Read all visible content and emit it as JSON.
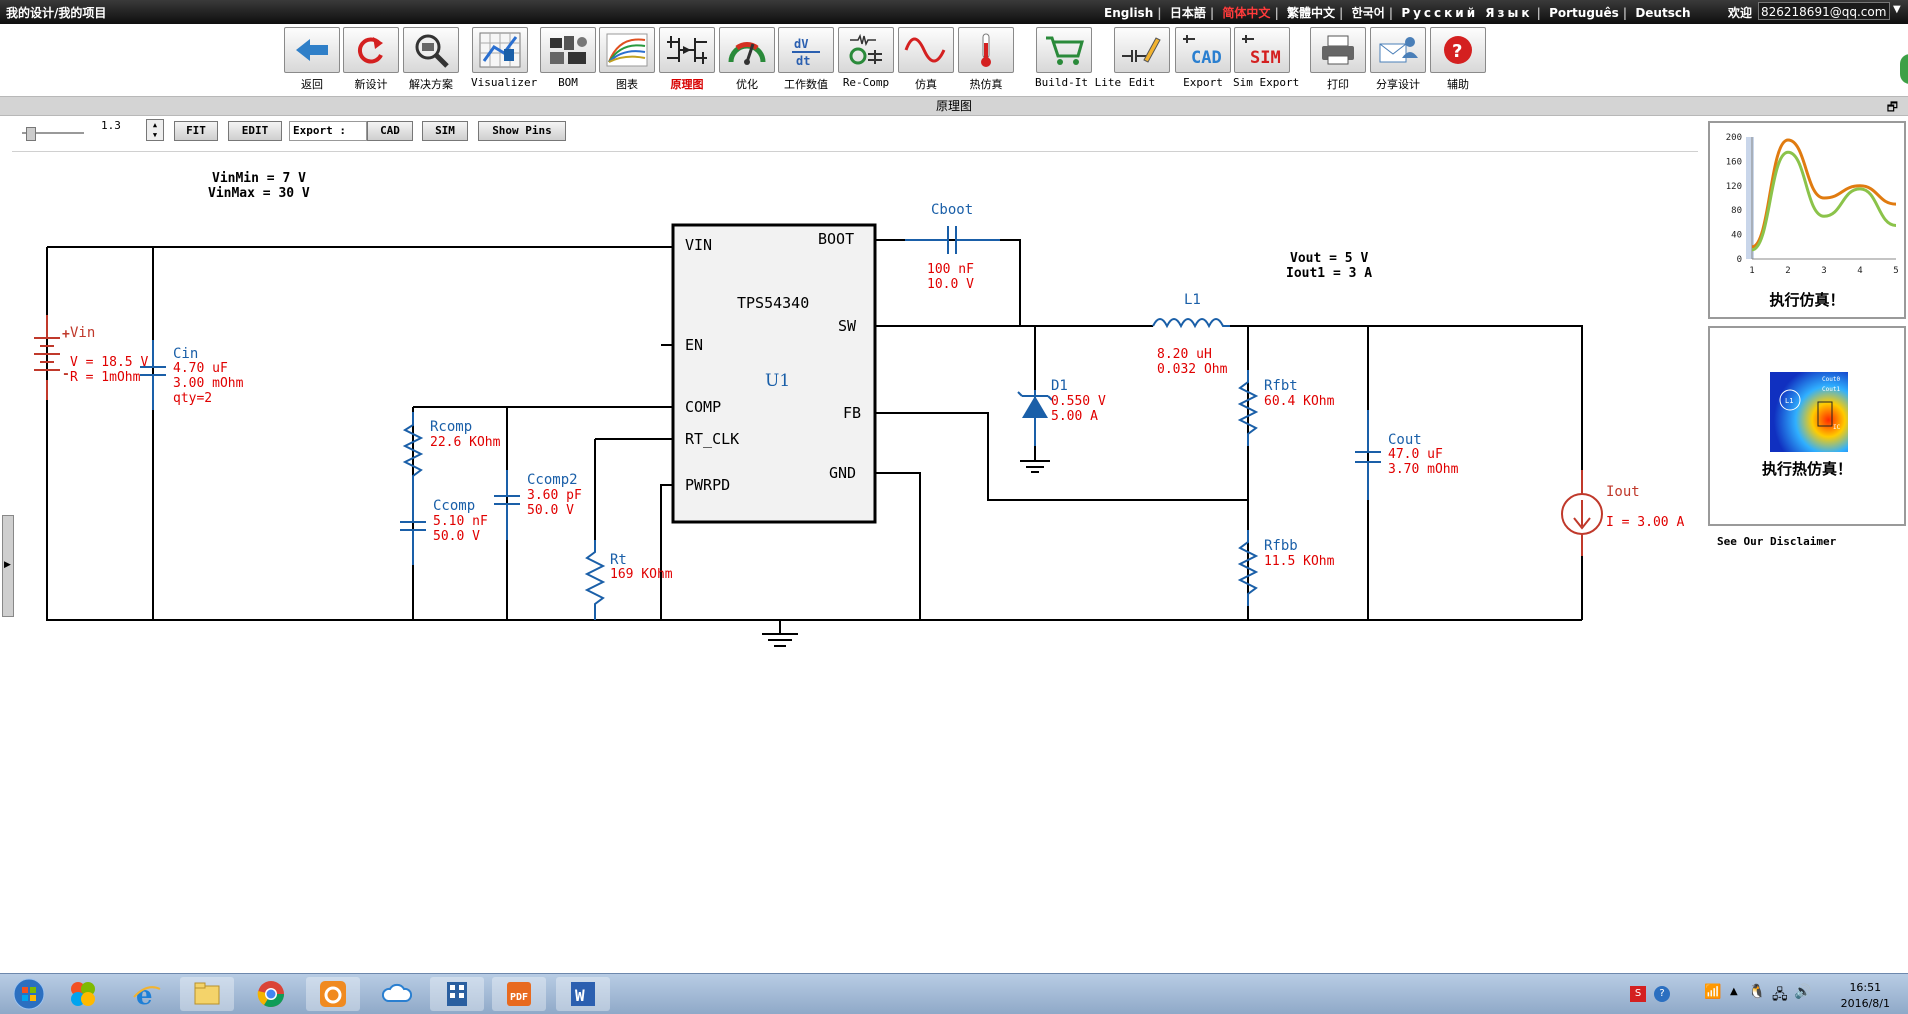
{
  "topbar": {
    "breadcrumb": "我的设计/我的项目",
    "languages": [
      "English",
      "日本語",
      "简体中文",
      "繁體中文",
      "한국어",
      "Русский Язык",
      "Português",
      "Deutsch"
    ],
    "active_language": "简体中文",
    "welcome": "欢迎",
    "account": "826218691@qq.com"
  },
  "toolbar": [
    {
      "label": "返回",
      "icon": "back-arrow-icon"
    },
    {
      "label": "新设计",
      "icon": "refresh-icon"
    },
    {
      "label": "解决方案",
      "icon": "magnifier-icon"
    },
    {
      "label": "Visualizer",
      "icon": "visualizer-icon"
    },
    {
      "label": "BOM",
      "icon": "bom-icon"
    },
    {
      "label": "图表",
      "icon": "chart-icon"
    },
    {
      "label": "原理图",
      "icon": "schematic-icon",
      "active": true
    },
    {
      "label": "优化",
      "icon": "gauge-icon"
    },
    {
      "label": "工作数值",
      "icon": "dvdt-icon"
    },
    {
      "label": "Re-Comp",
      "icon": "recomp-icon"
    },
    {
      "label": "仿真",
      "icon": "sine-icon"
    },
    {
      "label": "热仿真",
      "icon": "thermometer-icon"
    },
    {
      "label": "Build-It Lite",
      "icon": "cart-icon"
    },
    {
      "label": "Edit",
      "icon": "edit-icon"
    },
    {
      "label": "Export",
      "icon": "cad-icon"
    },
    {
      "label": "Sim Export",
      "icon": "sim-icon"
    },
    {
      "label": "打印",
      "icon": "printer-icon"
    },
    {
      "label": "分享设计",
      "icon": "share-icon"
    },
    {
      "label": "辅助",
      "icon": "help-icon"
    }
  ],
  "panel": {
    "title": "原理图"
  },
  "controls": {
    "zoom": "1.3",
    "fit": "FIT",
    "edit": "EDIT",
    "export_label": "Export :",
    "cad": "CAD",
    "sim": "SIM",
    "show_pins": "Show Pins"
  },
  "schematic": {
    "vin_min": "VinMin = 7 V",
    "vin_max": "VinMax = 30 V",
    "vout": "Vout = 5 V",
    "iout1": "Iout1 = 3 A",
    "ic": {
      "part": "TPS54340",
      "ref": "U1",
      "pins": {
        "vin": "VIN",
        "en": "EN",
        "comp": "COMP",
        "rt_clk": "RT_CLK",
        "pwrpd": "PWRPD",
        "boot": "BOOT",
        "sw": "SW",
        "fb": "FB",
        "gnd": "GND"
      }
    },
    "vin": {
      "name": "Vin",
      "v": "V = 18.5 V",
      "r": "R = 1mOhm"
    },
    "cin": {
      "name": "Cin",
      "c": "4.70 uF",
      "esr": "3.00 mOhm",
      "qty": "qty=2"
    },
    "rcomp": {
      "name": "Rcomp",
      "r": "22.6 KOhm"
    },
    "ccomp": {
      "name": "Ccomp",
      "c": "5.10 nF",
      "v": "50.0 V"
    },
    "ccomp2": {
      "name": "Ccomp2",
      "c": "3.60 pF",
      "v": "50.0 V"
    },
    "rt": {
      "name": "Rt",
      "r": "169 KOhm"
    },
    "cboot": {
      "name": "Cboot",
      "c": "100 nF",
      "v": "10.0 V"
    },
    "l1": {
      "name": "L1",
      "l": "8.20 uH",
      "r": "0.032 Ohm"
    },
    "d1": {
      "name": "D1",
      "v": "0.550 V",
      "i": "5.00 A"
    },
    "rfbt": {
      "name": "Rfbt",
      "r": "60.4 KOhm"
    },
    "rfbb": {
      "name": "Rfbb",
      "r": "11.5 KOhm"
    },
    "cout": {
      "name": "Cout",
      "c": "47.0 uF",
      "esr": "3.70 mOhm"
    },
    "iout": {
      "name": "Iout",
      "i": "I = 3.00 A"
    }
  },
  "sim_panel": {
    "caption": "执行仿真！"
  },
  "thermal_panel": {
    "caption": "执行热仿真！",
    "tiny_labels": [
      "L1",
      "Cout0",
      "Cout1",
      "IC"
    ]
  },
  "disclaimer": "See Our Disclaimer",
  "chart_data": {
    "type": "line",
    "x": [
      1,
      2,
      3,
      4,
      5
    ],
    "xlim": [
      1,
      5
    ],
    "ylim": [
      0,
      200
    ],
    "yticks": [
      0,
      40,
      80,
      120,
      160,
      200
    ],
    "xticks": [
      1,
      2,
      3,
      4,
      5
    ],
    "series": [
      {
        "color": "#e07b10",
        "values": [
          20,
          195,
          100,
          120,
          90
        ]
      },
      {
        "color": "#8bc34a",
        "values": [
          15,
          175,
          70,
          115,
          55
        ]
      }
    ]
  },
  "taskbar": {
    "apps": [
      "start-orb-icon",
      "windows-icon",
      "ie-icon",
      "explorer-icon",
      "chrome-icon",
      "uc-browser-icon",
      "baidu-cloud-icon",
      "video-icon",
      "pdf-icon",
      "word-icon"
    ],
    "time": "16:51",
    "date": "2016/8/1"
  },
  "colors": {
    "wire": "#000000",
    "part": "#1a5fa8",
    "value": "#e00000",
    "highlight": "#ff3b3b"
  }
}
